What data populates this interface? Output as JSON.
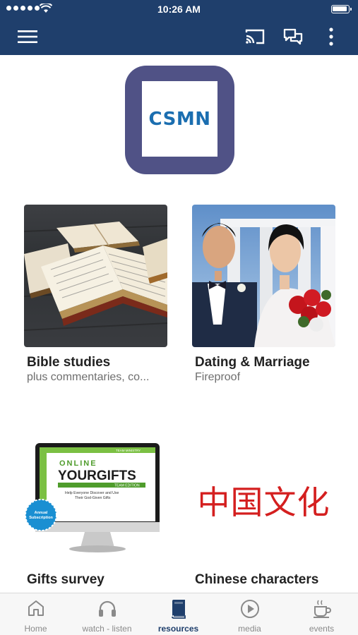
{
  "status": {
    "time": "10:26 AM"
  },
  "header": {
    "menu_icon": "hamburger-menu-icon",
    "cast_icon": "cast-icon",
    "chat_icon": "chat-bubbles-icon",
    "more_icon": "more-vertical-icon",
    "bar_color": "#1f3f6c"
  },
  "logo": {
    "text": "CSMN",
    "frame_color": "#505286",
    "text_color": "#1b6eb0"
  },
  "cards": [
    {
      "title": "Bible studies",
      "subtitle": "plus commentaries, co...",
      "image": "open-bibles-photo"
    },
    {
      "title": "Dating & Marriage",
      "subtitle": "Fireproof",
      "image": "wedding-couple-photo"
    },
    {
      "title": "Gifts survey",
      "subtitle": "",
      "image": "online-yourgifts-monitor",
      "image_text": {
        "line1": "ONLINE",
        "line2": "YOURGIFTS",
        "line3": "TEAM EDITION",
        "tagline": "Help Everyone Discover and Use Their God-Given Gifts",
        "badge": "Annual Subscription",
        "brand": "TEAM MINISTRY"
      }
    },
    {
      "title": "Chinese characters",
      "subtitle": "",
      "image_text": "中国文化"
    }
  ],
  "nav": [
    {
      "label": "Home",
      "icon": "home-icon",
      "active": false
    },
    {
      "label": "watch - listen",
      "icon": "headphones-icon",
      "active": false
    },
    {
      "label": "resources",
      "icon": "book-icon",
      "active": true
    },
    {
      "label": "media",
      "icon": "play-circle-icon",
      "active": false
    },
    {
      "label": "events",
      "icon": "coffee-cup-icon",
      "active": false
    }
  ],
  "colors": {
    "accent": "#1f3f6c",
    "inactive": "#8a8a8a",
    "chinese_red": "#d41f1f"
  }
}
